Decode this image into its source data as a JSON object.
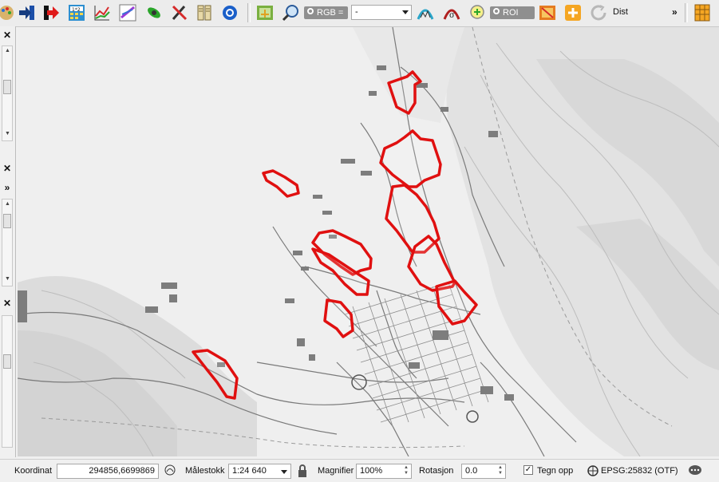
{
  "toolbar": {
    "rgb_label": "RGB =",
    "rgb_value": "-",
    "roi_label": "ROI",
    "dist_label": "Dist",
    "overflow": "»",
    "icons": [
      "paint-palette-icon",
      "move-right-icon",
      "exit-icon",
      "calculator-icon",
      "graph-icon",
      "scatter-plot-icon",
      "satellite-icon",
      "tools-icon",
      "book-icon",
      "settings-ring-icon",
      "layers-icon",
      "zoom-icon",
      "spectral-profile-icon",
      "signature-icon",
      "magnifier-add-icon",
      "band-combination-icon",
      "add-icon",
      "refresh-icon",
      "table-icon"
    ]
  },
  "left_panel": {
    "close_symbol": "✕",
    "expand_symbol": "»"
  },
  "map": {
    "highlight_color": "#e01010",
    "background_color": "#f1f1f1"
  },
  "status": {
    "coordinate_label": "Koordinat",
    "coordinate_value": "294856,6699869",
    "scale_label": "Målestokk",
    "scale_value": "1:24 640",
    "magnifier_label": "Magnifier",
    "magnifier_value": "100%",
    "rotation_label": "Rotasjon",
    "rotation_value": "0.0",
    "render_label": "Tegn opp",
    "render_checked": true,
    "crs_label": "EPSG:25832 (OTF)"
  }
}
